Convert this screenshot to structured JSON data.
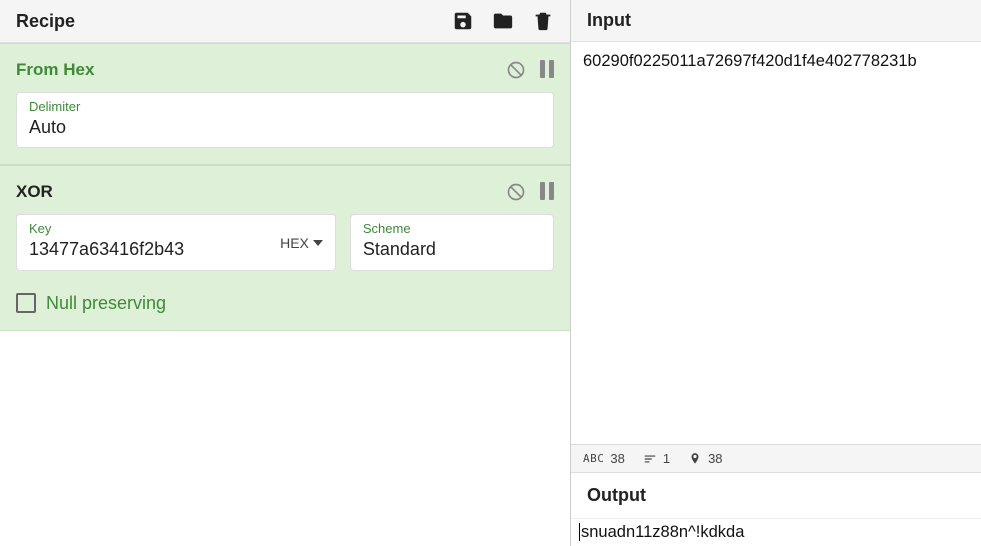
{
  "recipe": {
    "title": "Recipe",
    "operations": [
      {
        "name": "From Hex",
        "fields": {
          "delimiter_label": "Delimiter",
          "delimiter_value": "Auto"
        }
      },
      {
        "name": "XOR",
        "fields": {
          "key_label": "Key",
          "key_value": "13477a63416f2b43",
          "key_type": "HEX",
          "scheme_label": "Scheme",
          "scheme_value": "Standard"
        },
        "null_preserving_label": "Null preserving",
        "null_preserving_checked": false
      }
    ]
  },
  "input": {
    "title": "Input",
    "value": "60290f0225011a72697f420d1f4e402778231b"
  },
  "status": {
    "chars": "38",
    "lines": "1",
    "pos": "38"
  },
  "output": {
    "title": "Output",
    "value": "snuadn11z88n^!kdkda"
  }
}
